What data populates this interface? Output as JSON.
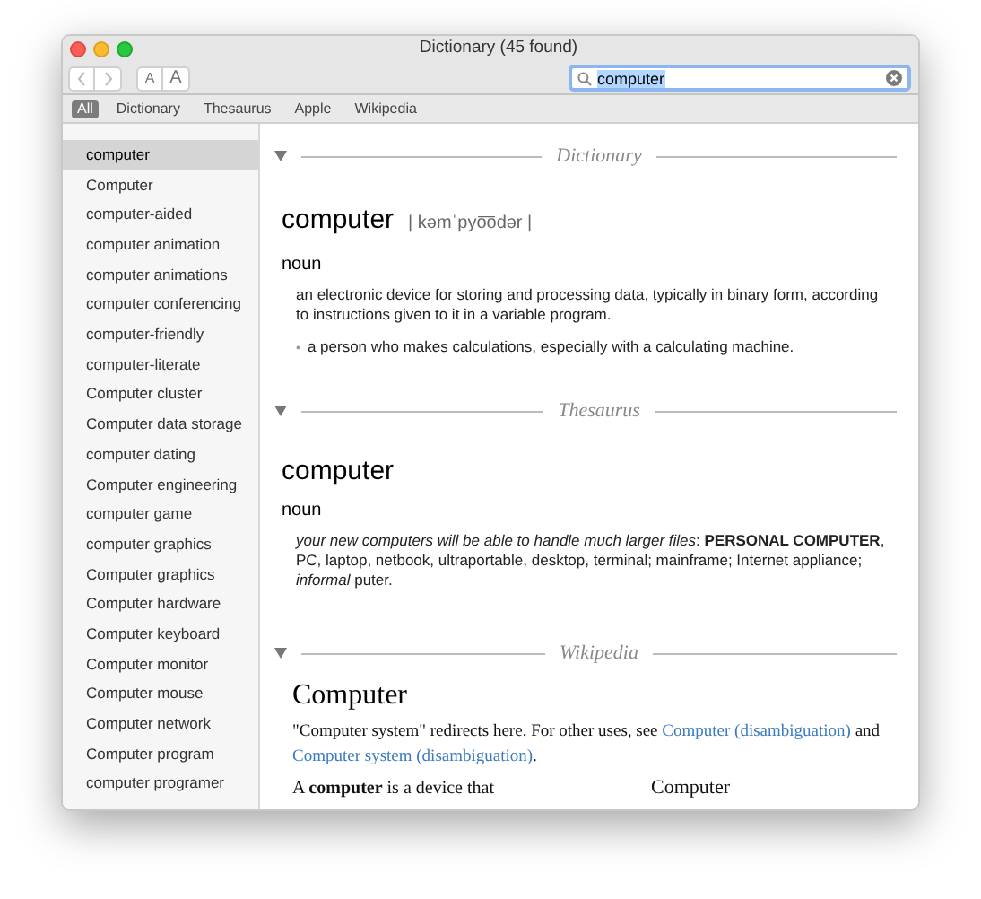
{
  "window": {
    "title": "Dictionary (45 found)"
  },
  "toolbar": {
    "font_smaller": "A",
    "font_larger": "A",
    "search": {
      "value": "computer",
      "selected_text": true
    }
  },
  "tabs": [
    {
      "label": "All",
      "selected": true
    },
    {
      "label": "Dictionary",
      "selected": false
    },
    {
      "label": "Thesaurus",
      "selected": false
    },
    {
      "label": "Apple",
      "selected": false
    },
    {
      "label": "Wikipedia",
      "selected": false
    }
  ],
  "sidebar": {
    "items": [
      {
        "label": "computer",
        "selected": true
      },
      {
        "label": "Computer",
        "selected": false
      },
      {
        "label": "computer-aided",
        "selected": false
      },
      {
        "label": "computer animation",
        "selected": false
      },
      {
        "label": "computer animations",
        "selected": false
      },
      {
        "label": "computer conferencing",
        "selected": false
      },
      {
        "label": "computer-friendly",
        "selected": false
      },
      {
        "label": "computer-literate",
        "selected": false
      },
      {
        "label": "Computer cluster",
        "selected": false
      },
      {
        "label": "Computer data storage",
        "selected": false
      },
      {
        "label": "computer dating",
        "selected": false
      },
      {
        "label": "Computer engineering",
        "selected": false
      },
      {
        "label": "computer game",
        "selected": false
      },
      {
        "label": "computer graphics",
        "selected": false
      },
      {
        "label": "Computer graphics",
        "selected": false
      },
      {
        "label": "Computer hardware",
        "selected": false
      },
      {
        "label": "Computer keyboard",
        "selected": false
      },
      {
        "label": "Computer monitor",
        "selected": false
      },
      {
        "label": "Computer mouse",
        "selected": false
      },
      {
        "label": "Computer network",
        "selected": false
      },
      {
        "label": "Computer program",
        "selected": false
      },
      {
        "label": "computer programer",
        "selected": false
      }
    ]
  },
  "sections": [
    {
      "kind": "dictionary",
      "title": "Dictionary",
      "expanded": true,
      "headword": "computer",
      "pronunciation": "| kəmˈpyo͞odər |",
      "part_of_speech": "noun",
      "definition": "an electronic device for storing and processing data, typically in binary form, according to instructions given to it in a variable program.",
      "bullet": "•",
      "subsense": "a person who makes calculations, especially with a calculating machine."
    },
    {
      "kind": "thesaurus",
      "title": "Thesaurus",
      "expanded": true,
      "headword": "computer",
      "part_of_speech": "noun",
      "entry": "*your new computers will be able to handle much larger files*: **PERSONAL COMPUTER**, PC, laptop, netbook, ultraportable, desktop, terminal; mainframe; Internet appliance; *informal* puter."
    },
    {
      "kind": "wikipedia",
      "title": "Wikipedia",
      "expanded": true,
      "headword": "Computer",
      "intro": [
        {
          "kind": "text",
          "text": "\"Computer system\" redirects here. For other uses, see "
        },
        {
          "kind": "link",
          "text": "Computer (disambiguation)"
        },
        {
          "kind": "text",
          "text": " and "
        },
        {
          "kind": "link",
          "text": "Computer system (disambiguation)"
        },
        {
          "kind": "text",
          "text": "."
        }
      ],
      "lead": "A **computer** is a device that",
      "infobox_title": "Computer"
    }
  ]
}
